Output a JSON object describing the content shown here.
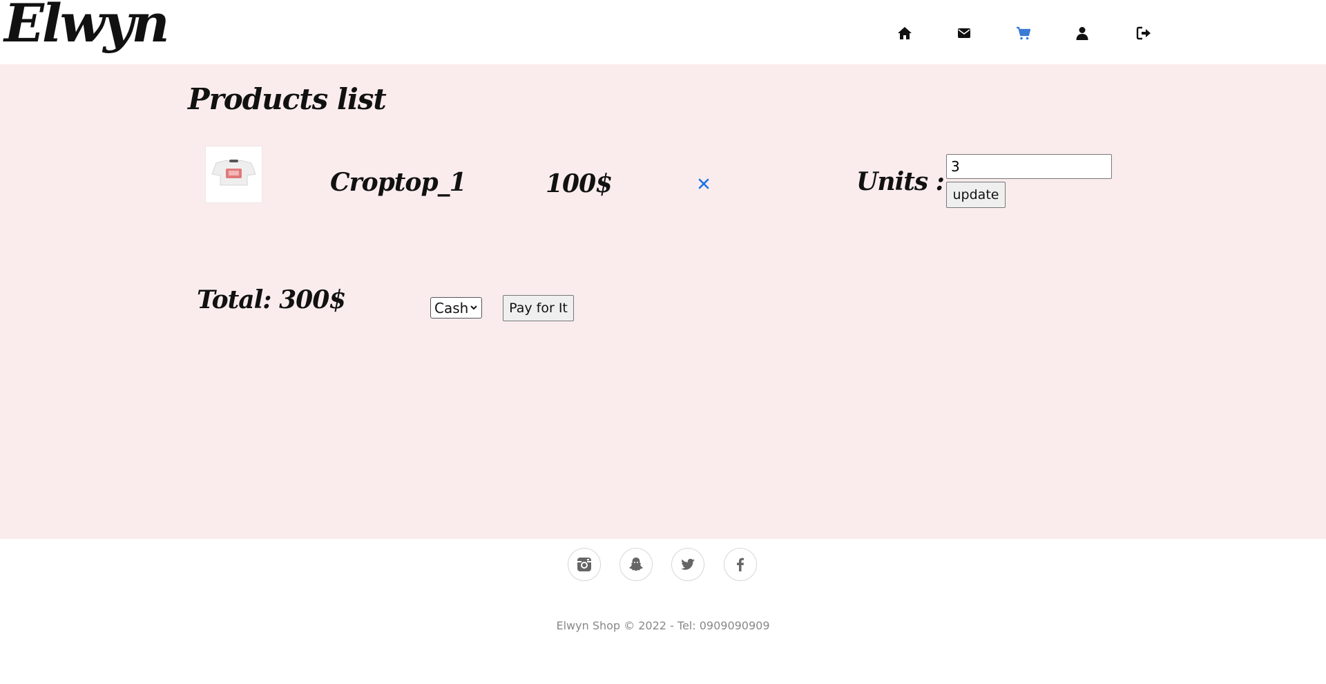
{
  "header": {
    "logo": "Elwyn",
    "nav": [
      {
        "name": "home-icon",
        "color": "#111111"
      },
      {
        "name": "envelope-icon",
        "color": "#111111"
      },
      {
        "name": "cart-icon",
        "color": "#3a7bd5",
        "active": true
      },
      {
        "name": "user-icon",
        "color": "#111111"
      },
      {
        "name": "sign-out-icon",
        "color": "#111111"
      }
    ]
  },
  "main": {
    "title": "Products list",
    "background": "#faeced",
    "item": {
      "name": "Croptop_1",
      "price": "100$",
      "units_label": "Units :",
      "units_value": "3",
      "update_label": "update",
      "remove_icon": "close-icon",
      "remove_color": "#1a73e8"
    },
    "total": "Total: 300$",
    "payment": {
      "selected": "Cash"
    },
    "pay_label": "Pay for It"
  },
  "footer": {
    "social": [
      "instagram-icon",
      "snapchat-icon",
      "twitter-icon",
      "facebook-icon"
    ],
    "copyright": "Elwyn Shop © 2022 - Tel: 0909090909"
  }
}
